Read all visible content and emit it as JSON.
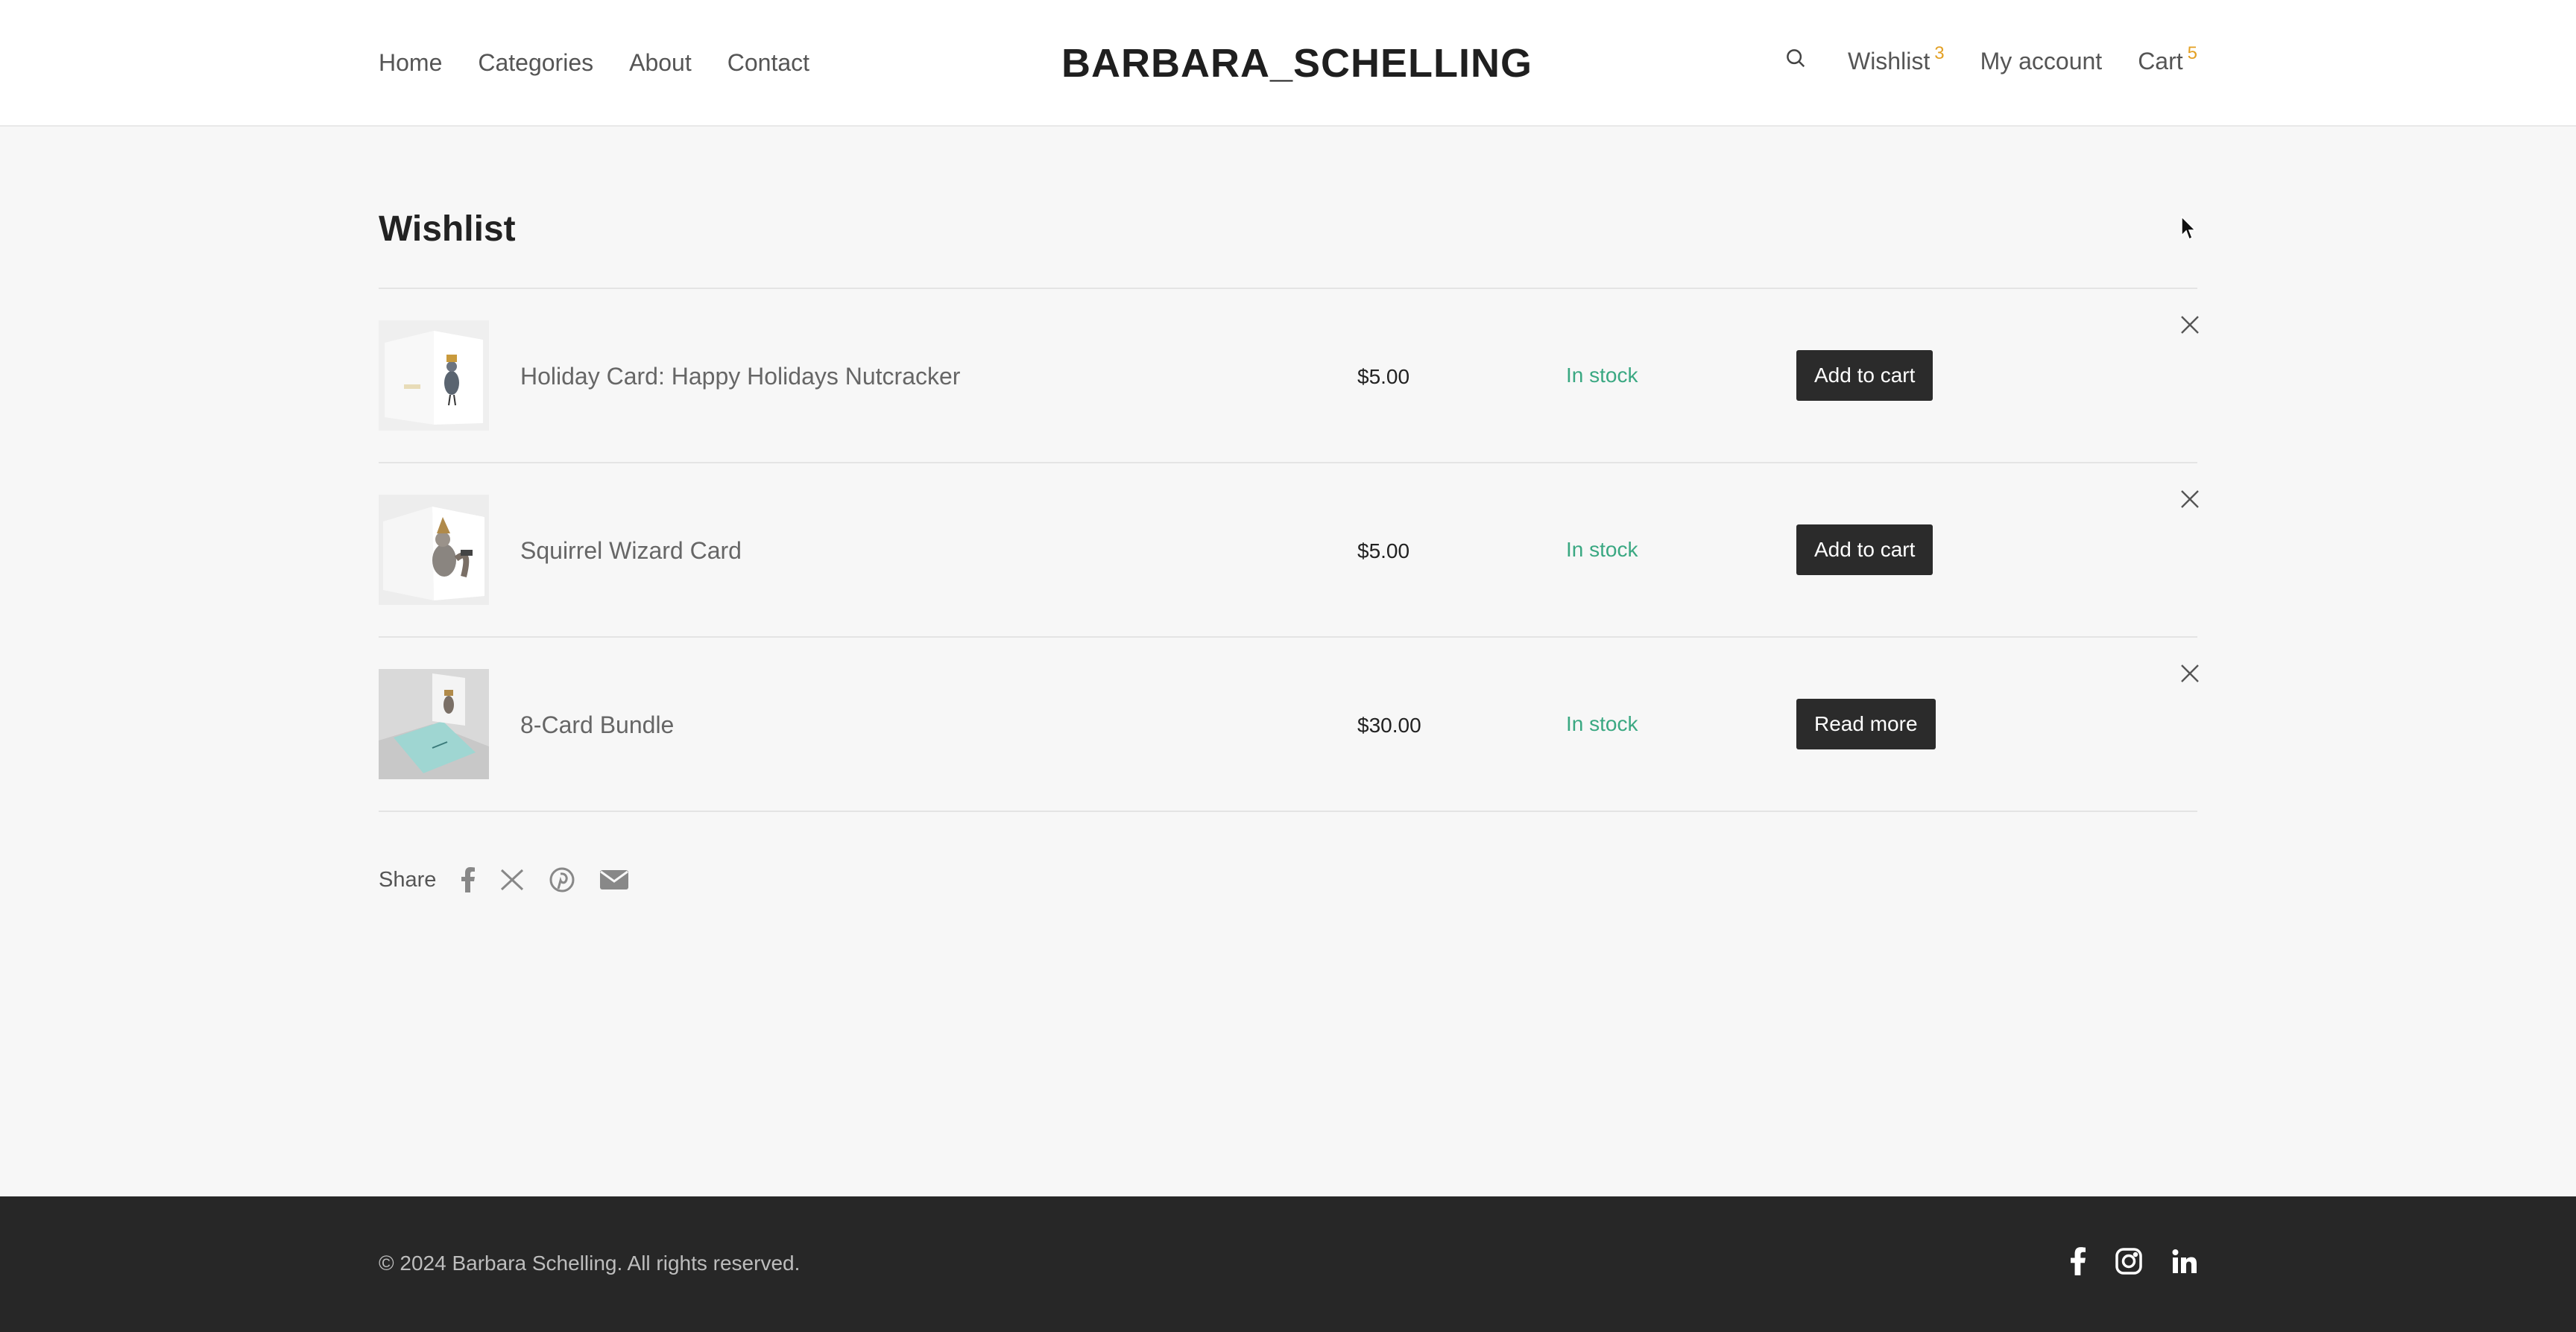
{
  "header": {
    "nav": [
      "Home",
      "Categories",
      "About",
      "Contact"
    ],
    "logo": "BARBARA_SCHELLING",
    "wishlist_label": "Wishlist",
    "wishlist_count": "3",
    "account_label": "My account",
    "cart_label": "Cart",
    "cart_count": "5"
  },
  "main": {
    "title": "Wishlist",
    "items": [
      {
        "name": "Holiday Card: Happy Holidays Nutcracker",
        "price": "$5.00",
        "stock": "In stock",
        "action": "Add to cart"
      },
      {
        "name": "Squirrel Wizard Card",
        "price": "$5.00",
        "stock": "In stock",
        "action": "Add to cart"
      },
      {
        "name": "8-Card Bundle",
        "price": "$30.00",
        "stock": "In stock",
        "action": "Read more"
      }
    ],
    "share_label": "Share"
  },
  "footer": {
    "copyright": "© 2024 Barbara Schelling. All rights reserved."
  },
  "icons": {
    "search": "search-icon",
    "remove": "close-icon",
    "share": [
      "facebook-icon",
      "x-icon",
      "pinterest-icon",
      "email-icon"
    ],
    "footer": [
      "facebook-icon",
      "instagram-icon",
      "linkedin-icon"
    ]
  },
  "colors": {
    "badge": "#e3a024",
    "in_stock": "#3aa882",
    "button": "#2b2b2b",
    "footer_bg": "#272727"
  }
}
